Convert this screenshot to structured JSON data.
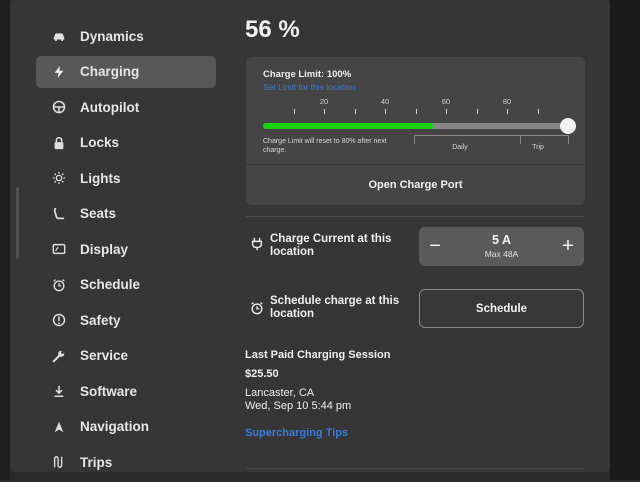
{
  "sidebar": {
    "items": [
      {
        "label": "Dynamics",
        "icon": "car-icon"
      },
      {
        "label": "Charging",
        "icon": "bolt-icon",
        "active": true
      },
      {
        "label": "Autopilot",
        "icon": "steering-wheel-icon"
      },
      {
        "label": "Locks",
        "icon": "lock-icon"
      },
      {
        "label": "Lights",
        "icon": "sun-icon"
      },
      {
        "label": "Seats",
        "icon": "seat-icon"
      },
      {
        "label": "Display",
        "icon": "display-icon"
      },
      {
        "label": "Schedule",
        "icon": "alarm-clock-icon"
      },
      {
        "label": "Safety",
        "icon": "alert-circle-icon"
      },
      {
        "label": "Service",
        "icon": "wrench-icon"
      },
      {
        "label": "Software",
        "icon": "download-icon"
      },
      {
        "label": "Navigation",
        "icon": "navigation-arrow-icon"
      },
      {
        "label": "Trips",
        "icon": "trips-icon"
      }
    ]
  },
  "charge": {
    "percent_label": "56 %",
    "limit_label": "Charge Limit: 100%",
    "limit_link": "Set Limit for this location",
    "limit_value": 100,
    "current_level": 56,
    "tick_labels": [
      "20",
      "40",
      "60",
      "80"
    ],
    "reset_note": "Charge Limit will reset to 80% after next charge.",
    "zone_daily": "Daily",
    "zone_trip": "Trip",
    "open_port_label": "Open Charge Port"
  },
  "current": {
    "label": "Charge Current at this location",
    "minus": "−",
    "plus": "+",
    "value": "5 A",
    "max": "Max 48A"
  },
  "schedule": {
    "label": "Schedule charge at this location",
    "button": "Schedule"
  },
  "session": {
    "title": "Last Paid Charging Session",
    "amount": "$25.50",
    "location": "Lancaster, CA",
    "datetime": "Wed, Sep 10 5:44 pm",
    "tips_link": "Supercharging Tips"
  },
  "colors": {
    "accent_green": "#18d10f",
    "link_blue": "#3b7bd9"
  }
}
